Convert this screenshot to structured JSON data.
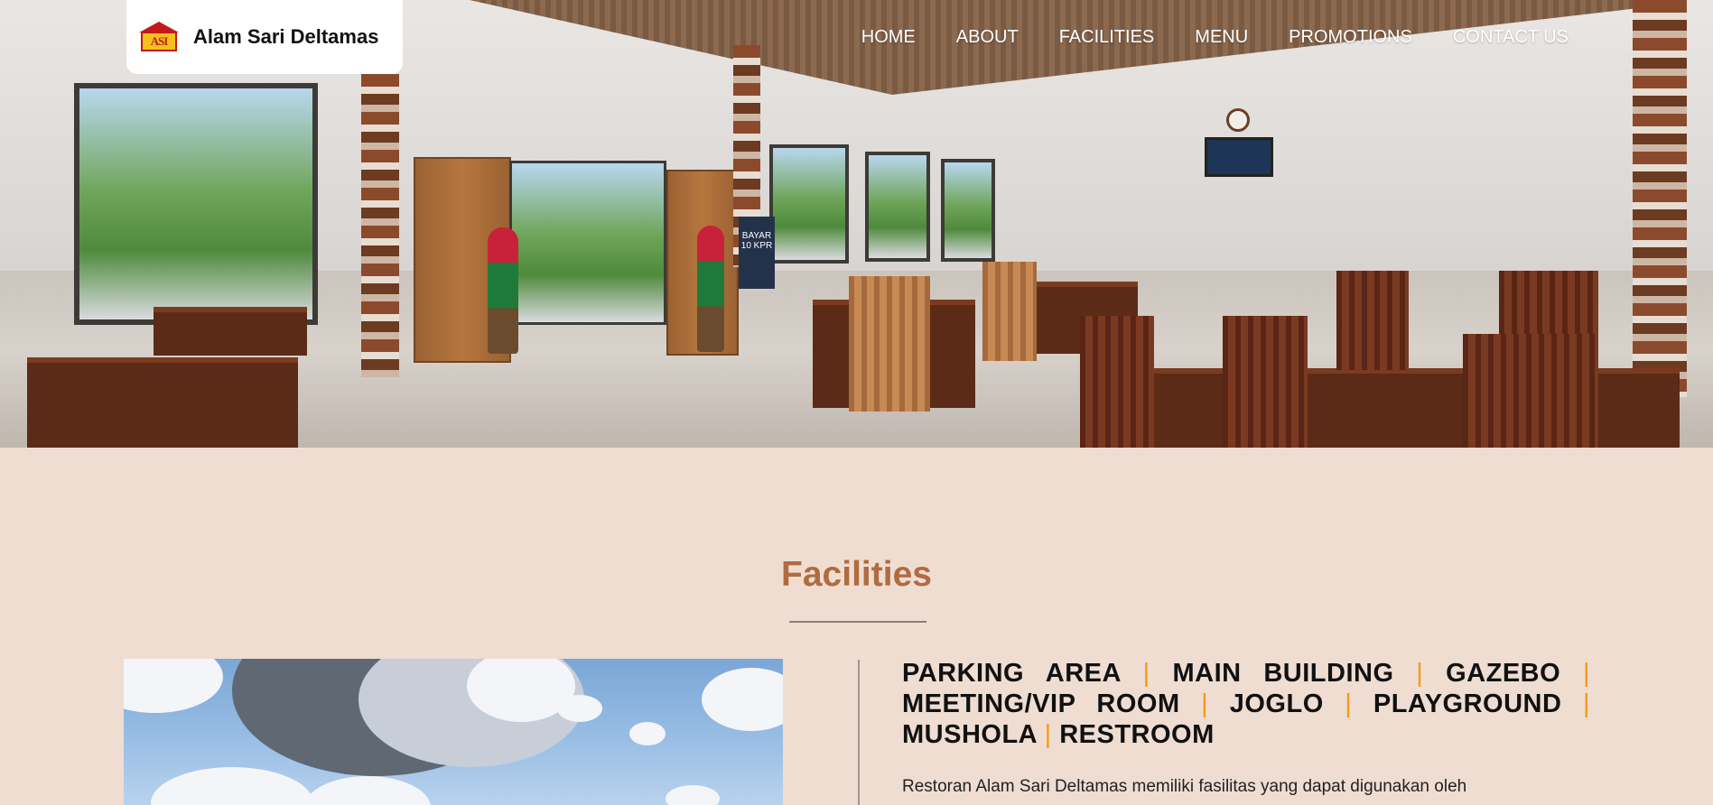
{
  "header": {
    "logo_mark_text": "ASI",
    "brand_name": "Alam Sari Deltamas",
    "nav": [
      {
        "label": "HOME"
      },
      {
        "label": "ABOUT"
      },
      {
        "label": "FACILITIES"
      },
      {
        "label": "MENU"
      },
      {
        "label": "PROMOTIONS"
      },
      {
        "label": "CONTACT US"
      }
    ]
  },
  "hero": {
    "standee_text": "BAYAR 10 KPR"
  },
  "facilities": {
    "title": "Facilities",
    "items": [
      "PARKING AREA",
      "MAIN BUILDING",
      "GAZEBO",
      "MEETING/VIP ROOM",
      "JOGLO",
      "PLAYGROUND",
      "MUSHOLA",
      "RESTROOM"
    ],
    "separator": "|",
    "description": "Restoran Alam Sari Deltamas memiliki fasilitas yang dapat digunakan oleh"
  },
  "colors": {
    "page_background": "#efddd2",
    "title_accent": "#b06b3f",
    "separator_accent": "#f39a17",
    "logo_red": "#c4191b",
    "logo_yellow": "#f2c21b"
  }
}
